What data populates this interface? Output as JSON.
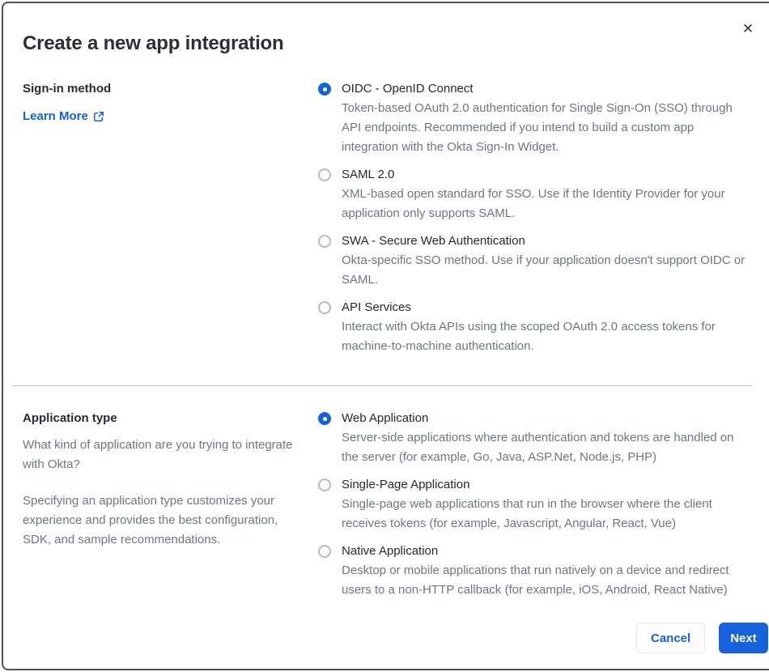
{
  "dialog": {
    "title": "Create a new app integration",
    "close_icon": "✕"
  },
  "colors": {
    "accent_blue": "#1662dd",
    "text_dark": "#282c30",
    "text_muted": "#6e7780",
    "modal_border": "#4f5357"
  },
  "sections": [
    {
      "label": "Sign-in method",
      "link": {
        "label": "Learn More",
        "icon": "external-link-icon"
      },
      "paragraphs": [],
      "options": [
        {
          "label": "OIDC - OpenID Connect",
          "description": "Token-based OAuth 2.0 authentication for Single Sign-On (SSO) through API endpoints. Recommended if you intend to build a custom app integration with the Okta Sign-In Widget.",
          "selected": true
        },
        {
          "label": "SAML 2.0",
          "description": "XML-based open standard for SSO. Use if the Identity Provider for your application only supports SAML.",
          "selected": false
        },
        {
          "label": "SWA - Secure Web Authentication",
          "description": "Okta-specific SSO method. Use if your application doesn't support OIDC or SAML.",
          "selected": false
        },
        {
          "label": "API Services",
          "description": "Interact with Okta APIs using the scoped OAuth 2.0 access tokens for machine-to-machine authentication.",
          "selected": false
        }
      ]
    },
    {
      "label": "Application type",
      "paragraphs": [
        "What kind of application are you trying to integrate with Okta?",
        "Specifying an application type customizes your experience and provides the best configuration, SDK, and sample recommendations."
      ],
      "options": [
        {
          "label": "Web Application",
          "description": "Server-side applications where authentication and tokens are handled on the server (for example, Go, Java, ASP.Net, Node.js, PHP)",
          "selected": true
        },
        {
          "label": "Single-Page Application",
          "description": "Single-page web applications that run in the browser where the client receives tokens (for example, Javascript, Angular, React, Vue)",
          "selected": false
        },
        {
          "label": "Native Application",
          "description": "Desktop or mobile applications that run natively on a device and redirect users to a non-HTTP callback (for example, iOS, Android, React Native)",
          "selected": false
        }
      ]
    }
  ],
  "footer": {
    "cancel_label": "Cancel",
    "next_label": "Next"
  }
}
